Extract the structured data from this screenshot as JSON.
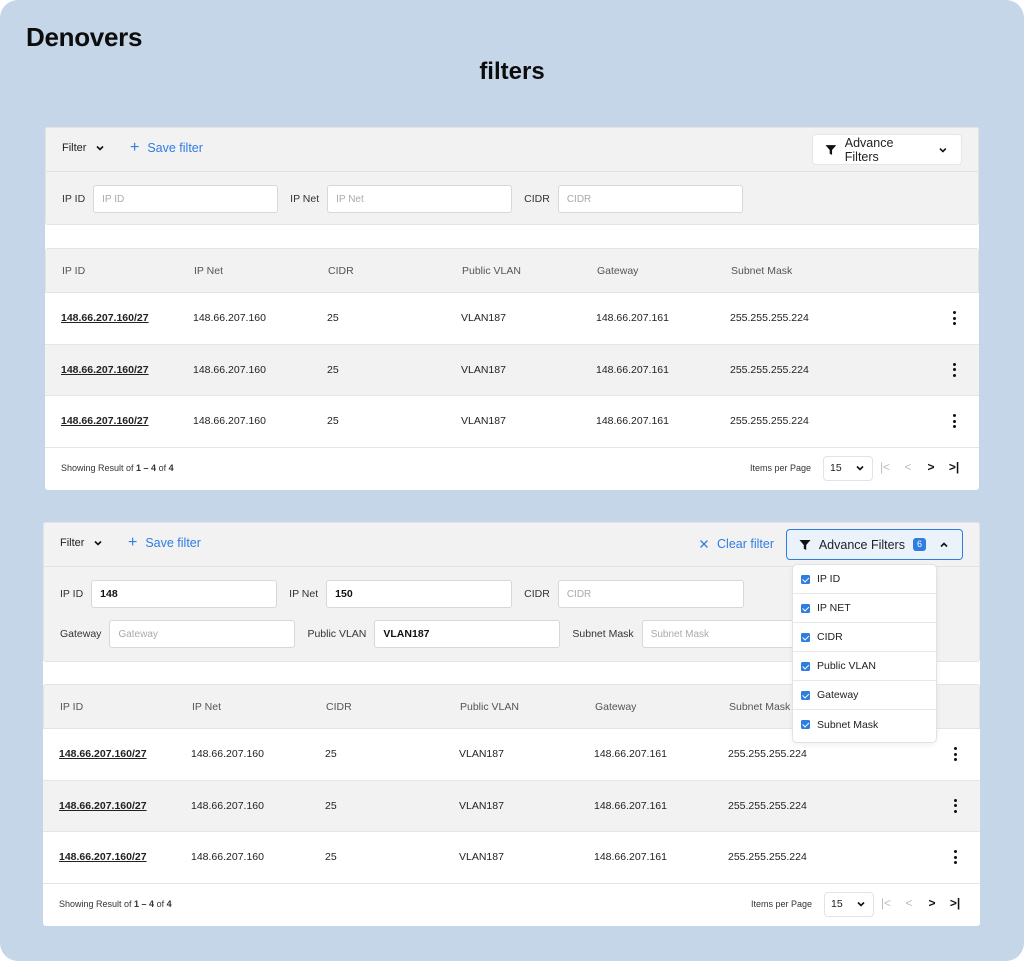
{
  "brand": "Denovers",
  "page_title": "filters",
  "colors": {
    "accent": "#2f7de1",
    "background": "#c5d6e8",
    "panel_header": "#f2f2f2"
  },
  "panel1": {
    "filter_dropdown_label": "Filter",
    "save_filter_label": "Save filter",
    "advance_filters_label": "Advance Filters",
    "fields": [
      {
        "label": "IP ID",
        "placeholder": "IP ID",
        "value": ""
      },
      {
        "label": "IP Net",
        "placeholder": "IP Net",
        "value": ""
      },
      {
        "label": "CIDR",
        "placeholder": "CIDR",
        "value": ""
      }
    ],
    "table": {
      "columns": [
        "IP ID",
        "IP Net",
        "CIDR",
        "Public VLAN",
        "Gateway",
        "Subnet Mask"
      ],
      "rows": [
        [
          "148.66.207.160/27",
          "148.66.207.160",
          "25",
          "VLAN187",
          "148.66.207.161",
          "255.255.255.224"
        ],
        [
          "148.66.207.160/27",
          "148.66.207.160",
          "25",
          "VLAN187",
          "148.66.207.161",
          "255.255.255.224"
        ],
        [
          "148.66.207.160/27",
          "148.66.207.160",
          "25",
          "VLAN187",
          "148.66.207.161",
          "255.255.255.224"
        ]
      ]
    },
    "footer": {
      "showing_prefix": "Showing Result of ",
      "range": "1 – 4",
      "of_word": " of ",
      "total": "4",
      "items_per_page_label": "Items per Page",
      "items_per_page_value": "15"
    }
  },
  "panel2": {
    "filter_dropdown_label": "Filter",
    "save_filter_label": "Save filter",
    "clear_filter_label": "Clear filter",
    "advance_filters_label": "Advance Filters",
    "advance_filters_count": "6",
    "fields_row1": [
      {
        "label": "IP ID",
        "placeholder": "IP ID",
        "value": "148"
      },
      {
        "label": "IP Net",
        "placeholder": "IP Net",
        "value": "150"
      },
      {
        "label": "CIDR",
        "placeholder": "CIDR",
        "value": ""
      }
    ],
    "fields_row2": [
      {
        "label": "Gateway",
        "placeholder": "Gateway",
        "value": ""
      },
      {
        "label": "Public VLAN",
        "placeholder": "Public VLAN",
        "value": "VLAN187"
      },
      {
        "label": "Subnet Mask",
        "placeholder": "Subnet Mask",
        "value": ""
      }
    ],
    "advance_filter_options": [
      {
        "label": "IP ID",
        "checked": true
      },
      {
        "label": "IP NET",
        "checked": true
      },
      {
        "label": "CIDR",
        "checked": true
      },
      {
        "label": "Public VLAN",
        "checked": true
      },
      {
        "label": "Gateway",
        "checked": true
      },
      {
        "label": "Subnet Mask",
        "checked": true
      }
    ],
    "table": {
      "columns": [
        "IP ID",
        "IP Net",
        "CIDR",
        "Public VLAN",
        "Gateway",
        "Subnet Mask"
      ],
      "rows": [
        [
          "148.66.207.160/27",
          "148.66.207.160",
          "25",
          "VLAN187",
          "148.66.207.161",
          "255.255.255.224"
        ],
        [
          "148.66.207.160/27",
          "148.66.207.160",
          "25",
          "VLAN187",
          "148.66.207.161",
          "255.255.255.224"
        ],
        [
          "148.66.207.160/27",
          "148.66.207.160",
          "25",
          "VLAN187",
          "148.66.207.161",
          "255.255.255.224"
        ]
      ]
    },
    "footer": {
      "showing_prefix": "Showing Result of ",
      "range": "1 – 4",
      "of_word": " of ",
      "total": "4",
      "items_per_page_label": "Items per Page",
      "items_per_page_value": "15"
    }
  },
  "icons": {
    "chevron_down": "chevron-down-icon",
    "chevron_up": "chevron-up-icon",
    "plus": "plus-icon",
    "filter_funnel": "funnel-icon",
    "close": "close-icon",
    "kebab": "more-vertical-icon",
    "first_page": "|<",
    "prev_page": "<",
    "next_page": ">",
    "last_page": ">|"
  }
}
